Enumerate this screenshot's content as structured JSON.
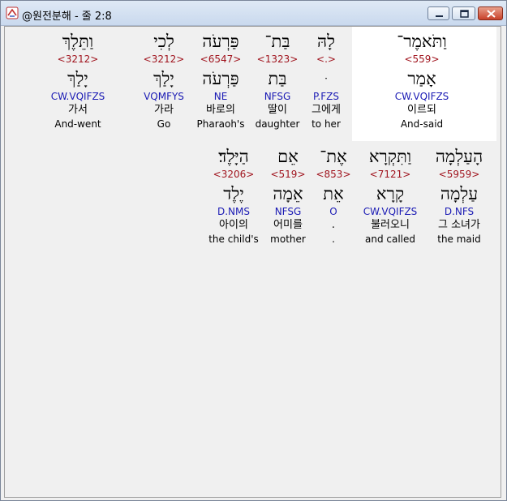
{
  "window": {
    "title": "@원전분해 - 줄 2:8",
    "buttons": {
      "minimize": "minimize-icon",
      "maximize": "maximize-icon",
      "close": "close-icon"
    }
  },
  "rows": [
    {
      "words": [
        {
          "hebrew": "וַתֵּלֶךְ",
          "strong": "<3212>",
          "lemma": "יָלַךְ",
          "parse": "CW.VQIFZS",
          "korean": "가서",
          "english": "And-went"
        },
        {
          "hebrew": "לְכִי",
          "strong": "<3212>",
          "lemma": "יָלַךְ",
          "parse": "VQMFYS",
          "korean": "가라",
          "english": "Go"
        },
        {
          "hebrew": "פַּרְעֹה",
          "strong": "<6547>",
          "lemma": "פַּרְעֹה",
          "parse": "NE",
          "korean": "바로의",
          "english": "Pharaoh's"
        },
        {
          "hebrew": "בַּת־",
          "strong": "<1323>",
          "lemma": "בַּת",
          "parse": "NFSG",
          "korean": "딸이",
          "english": "daughter"
        },
        {
          "hebrew": "לָהּ",
          "strong": "<.>",
          "lemma": "ּ",
          "parse": "P.FZS",
          "korean": "그에게",
          "english": "to her"
        },
        {
          "hebrew": "וַתֹּאמֶר־",
          "strong": "<559>",
          "lemma": "אָמַר",
          "parse": "CW.VQIFZS",
          "korean": "이르되",
          "english": "And-said"
        }
      ]
    },
    {
      "words": [
        {
          "hebrew": "הַיָּלֶד׃",
          "strong": "<3206>",
          "lemma": "יֶלֶד",
          "parse": "D.NMS",
          "korean": "아이의",
          "english": "the child's"
        },
        {
          "hebrew": "אֵם",
          "strong": "<519>",
          "lemma": "אֵמָה",
          "parse": "NFSG",
          "korean": "어미를",
          "english": "mother"
        },
        {
          "hebrew": "אֶת־",
          "strong": "<853>",
          "lemma": "אֵת",
          "parse": "O",
          "korean": ".",
          "english": "."
        },
        {
          "hebrew": "וַתִּקְרָא",
          "strong": "<7121>",
          "lemma": "קָרָא",
          "parse": "CW.VQIFZS",
          "korean": "불러오니",
          "english": "and called"
        },
        {
          "hebrew": "הָעַלְמָה",
          "strong": "<5959>",
          "lemma": "עַלְמָה",
          "parse": "D.NFS",
          "korean": "그 소녀가",
          "english": "the maid"
        }
      ]
    }
  ]
}
